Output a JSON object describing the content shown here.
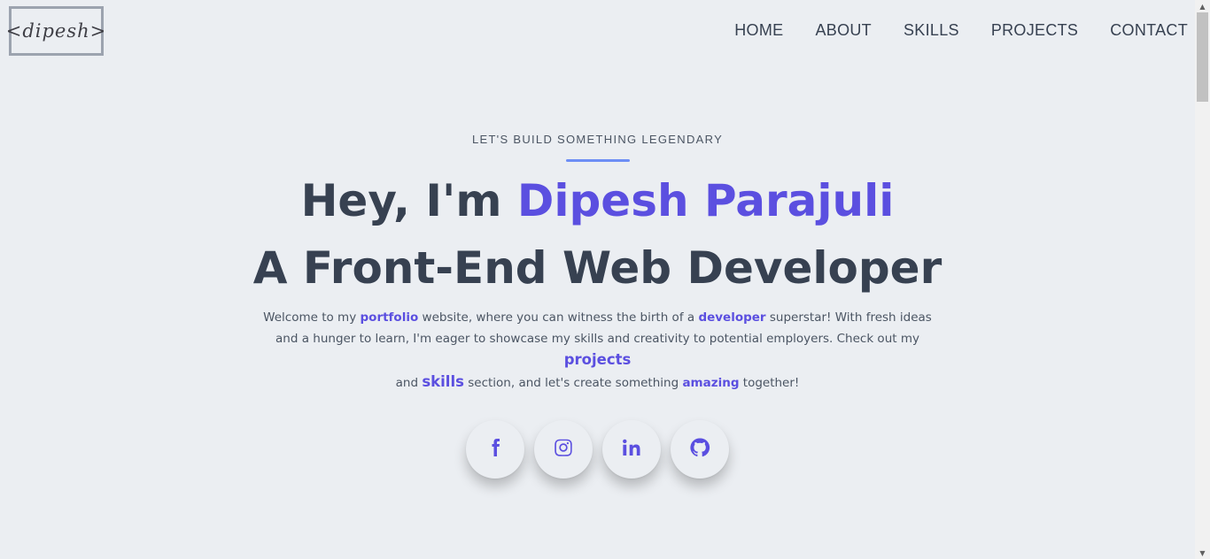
{
  "logo": {
    "text": "<dipesh>"
  },
  "nav": {
    "items": [
      {
        "label": "HOME"
      },
      {
        "label": "ABOUT"
      },
      {
        "label": "SKILLS"
      },
      {
        "label": "PROJECTS"
      },
      {
        "label": "CONTACT"
      }
    ]
  },
  "hero": {
    "tagline": "LET'S BUILD SOMETHING LEGENDARY",
    "greeting_prefix": "Hey, I'm ",
    "name": "Dipesh Parajuli",
    "role": "A Front-End Web Developer",
    "intro": {
      "p1": "Welcome to my ",
      "hl1": "portfolio",
      "p2": " website, where you can witness the birth of a ",
      "hl2": "developer",
      "p3": " superstar! With fresh ideas and a hunger to learn, I'm eager to showcase my skills and creativity to potential employers. Check out my ",
      "hl3": "projects",
      "p4": " and ",
      "hl4": "skills",
      "p5": " section, and let's create something ",
      "hl5": "amazing",
      "p6": " together!"
    }
  },
  "socials": [
    {
      "icon": "facebook-icon"
    },
    {
      "icon": "instagram-icon"
    },
    {
      "icon": "linkedin-icon"
    },
    {
      "icon": "github-icon"
    }
  ],
  "colors": {
    "background": "#ebeef2",
    "accent": "#5b4fe0",
    "underline": "#6d8ef5",
    "text": "#374151"
  }
}
